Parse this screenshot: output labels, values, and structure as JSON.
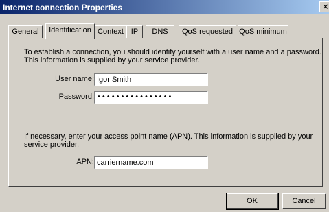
{
  "window": {
    "title": "Internet connection Properties",
    "close_glyph": "×"
  },
  "tabs": [
    {
      "label": "General",
      "active": false
    },
    {
      "label": "Identification",
      "active": true
    },
    {
      "label": "Context",
      "active": false
    },
    {
      "label": "IP",
      "active": false
    },
    {
      "label": "DNS",
      "active": false
    },
    {
      "label": "QoS requested",
      "active": false
    },
    {
      "label": "QoS minimum",
      "active": false
    }
  ],
  "identification": {
    "intro": "To establish a connection, you should identify yourself with a user name and a password. This information is supplied by your service provider.",
    "username_label": "User name:",
    "username_value": "Igor Smith",
    "password_label": "Password:",
    "password_value": "••••••••••••••••",
    "apn_intro": "If necessary, enter your access point name (APN). This information is supplied by your service provider.",
    "apn_label": "APN:",
    "apn_value": "carriername.com"
  },
  "buttons": {
    "ok": "OK",
    "cancel": "Cancel"
  }
}
